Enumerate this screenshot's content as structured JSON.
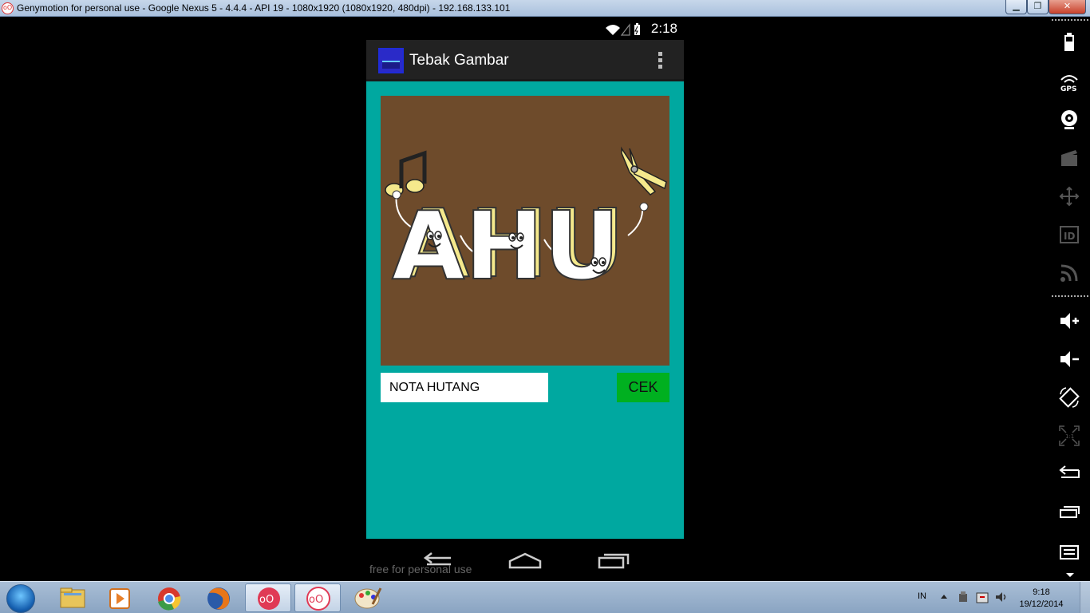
{
  "window": {
    "title": "Genymotion for personal use - Google Nexus 5 - 4.4.4 - API 19 - 1080x1920 (1080x1920, 480dpi) - 192.168.133.101",
    "minimize": "▁",
    "maximize": "❐",
    "close": "✕"
  },
  "statusbar": {
    "time": "2:18"
  },
  "actionbar": {
    "title": "Tebak Gambar"
  },
  "puzzle": {
    "text": "AHU",
    "background": "#6e4b2b"
  },
  "answer": {
    "value": "NOTA HUTANG"
  },
  "buttons": {
    "check_label": "CEK"
  },
  "watermark": "free for personal use",
  "colors": {
    "content_bg": "#00a8a0",
    "check_bg": "#00b020",
    "actionbar_bg": "#222222"
  },
  "taskbar": {
    "language": "IN",
    "time": "9:18",
    "date": "19/12/2014"
  },
  "sidebar_icons": [
    "battery-icon",
    "gps-icon",
    "webcam-icon",
    "capture-icon",
    "remote-control-icon",
    "device-id-icon",
    "rss-icon",
    "volume-up-icon",
    "volume-down-icon",
    "rotate-icon",
    "pixel-perfect-icon",
    "back-icon",
    "recent-apps-icon",
    "menu-icon"
  ]
}
